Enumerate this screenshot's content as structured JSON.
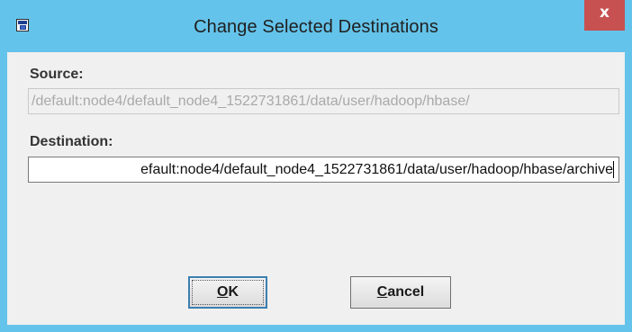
{
  "window": {
    "title": "Change Selected Destinations",
    "close_label": "x"
  },
  "source": {
    "label": "Source:",
    "value": "/default:node4/default_node4_1522731861/data/user/hadoop/hbase/"
  },
  "destination": {
    "label": "Destination:",
    "value": "efault:node4/default_node4_1522731861/data/user/hadoop/hbase/archive"
  },
  "buttons": {
    "ok_mnemonic": "O",
    "ok_rest": "K",
    "cancel_mnemonic": "C",
    "cancel_rest": "ancel"
  },
  "colors": {
    "titlebar": "#64c3ea",
    "close_button": "#c75050",
    "client": "#f0f0f0"
  }
}
